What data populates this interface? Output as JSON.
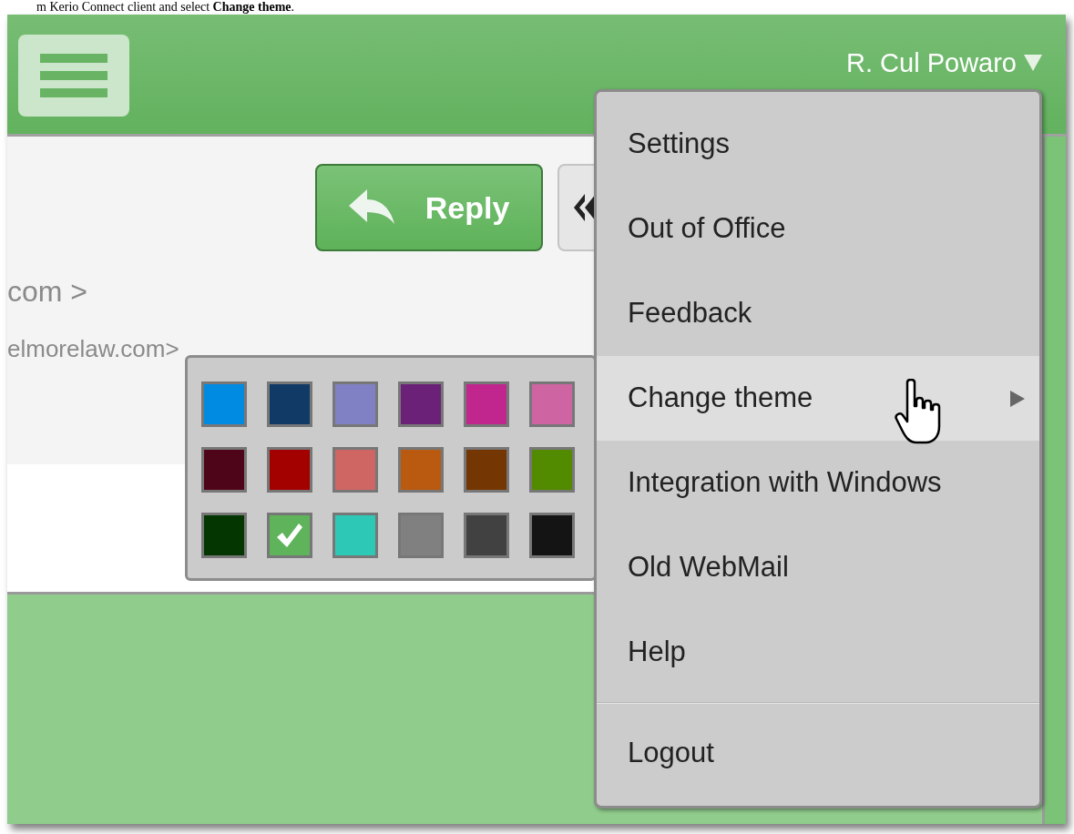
{
  "caption": "m Kerio Connect client and select **Change theme**.",
  "header": {
    "user_name": "R. Cul Powaro"
  },
  "message": {
    "reply_button": "Reply",
    "sender_lines": [
      "com >",
      "elmorelaw.com>"
    ]
  },
  "user_menu": {
    "items": [
      {
        "kind": "item",
        "label": "Settings",
        "selected": false,
        "submenu": false
      },
      {
        "kind": "item",
        "label": "Out of Office",
        "selected": false,
        "submenu": false
      },
      {
        "kind": "item",
        "label": "Feedback",
        "selected": false,
        "submenu": false
      },
      {
        "kind": "item",
        "label": "Change theme",
        "selected": true,
        "submenu": true
      },
      {
        "kind": "item",
        "label": "Integration with Windows",
        "selected": false,
        "submenu": false
      },
      {
        "kind": "item",
        "label": "Old WebMail",
        "selected": false,
        "submenu": false
      },
      {
        "kind": "item",
        "label": "Help",
        "selected": false,
        "submenu": false
      },
      {
        "kind": "divider"
      },
      {
        "kind": "item",
        "label": "Logout",
        "selected": false,
        "submenu": false
      }
    ]
  },
  "theme_palette": {
    "swatches": [
      {
        "color": "#008be3",
        "selected": false
      },
      {
        "color": "#123a66",
        "selected": false
      },
      {
        "color": "#8080c4",
        "selected": false
      },
      {
        "color": "#6c2178",
        "selected": false
      },
      {
        "color": "#c1268f",
        "selected": false
      },
      {
        "color": "#cf64a3",
        "selected": false
      },
      {
        "color": "#4f0519",
        "selected": false
      },
      {
        "color": "#a30000",
        "selected": false
      },
      {
        "color": "#cf6663",
        "selected": false
      },
      {
        "color": "#ba5a10",
        "selected": false
      },
      {
        "color": "#743602",
        "selected": false
      },
      {
        "color": "#528b00",
        "selected": false
      },
      {
        "color": "#033600",
        "selected": false
      },
      {
        "color": "#5fb35a",
        "selected": true
      },
      {
        "color": "#2ec8b6",
        "selected": false
      },
      {
        "color": "#808080",
        "selected": false
      },
      {
        "color": "#414141",
        "selected": false
      },
      {
        "color": "#141414",
        "selected": false
      }
    ]
  }
}
